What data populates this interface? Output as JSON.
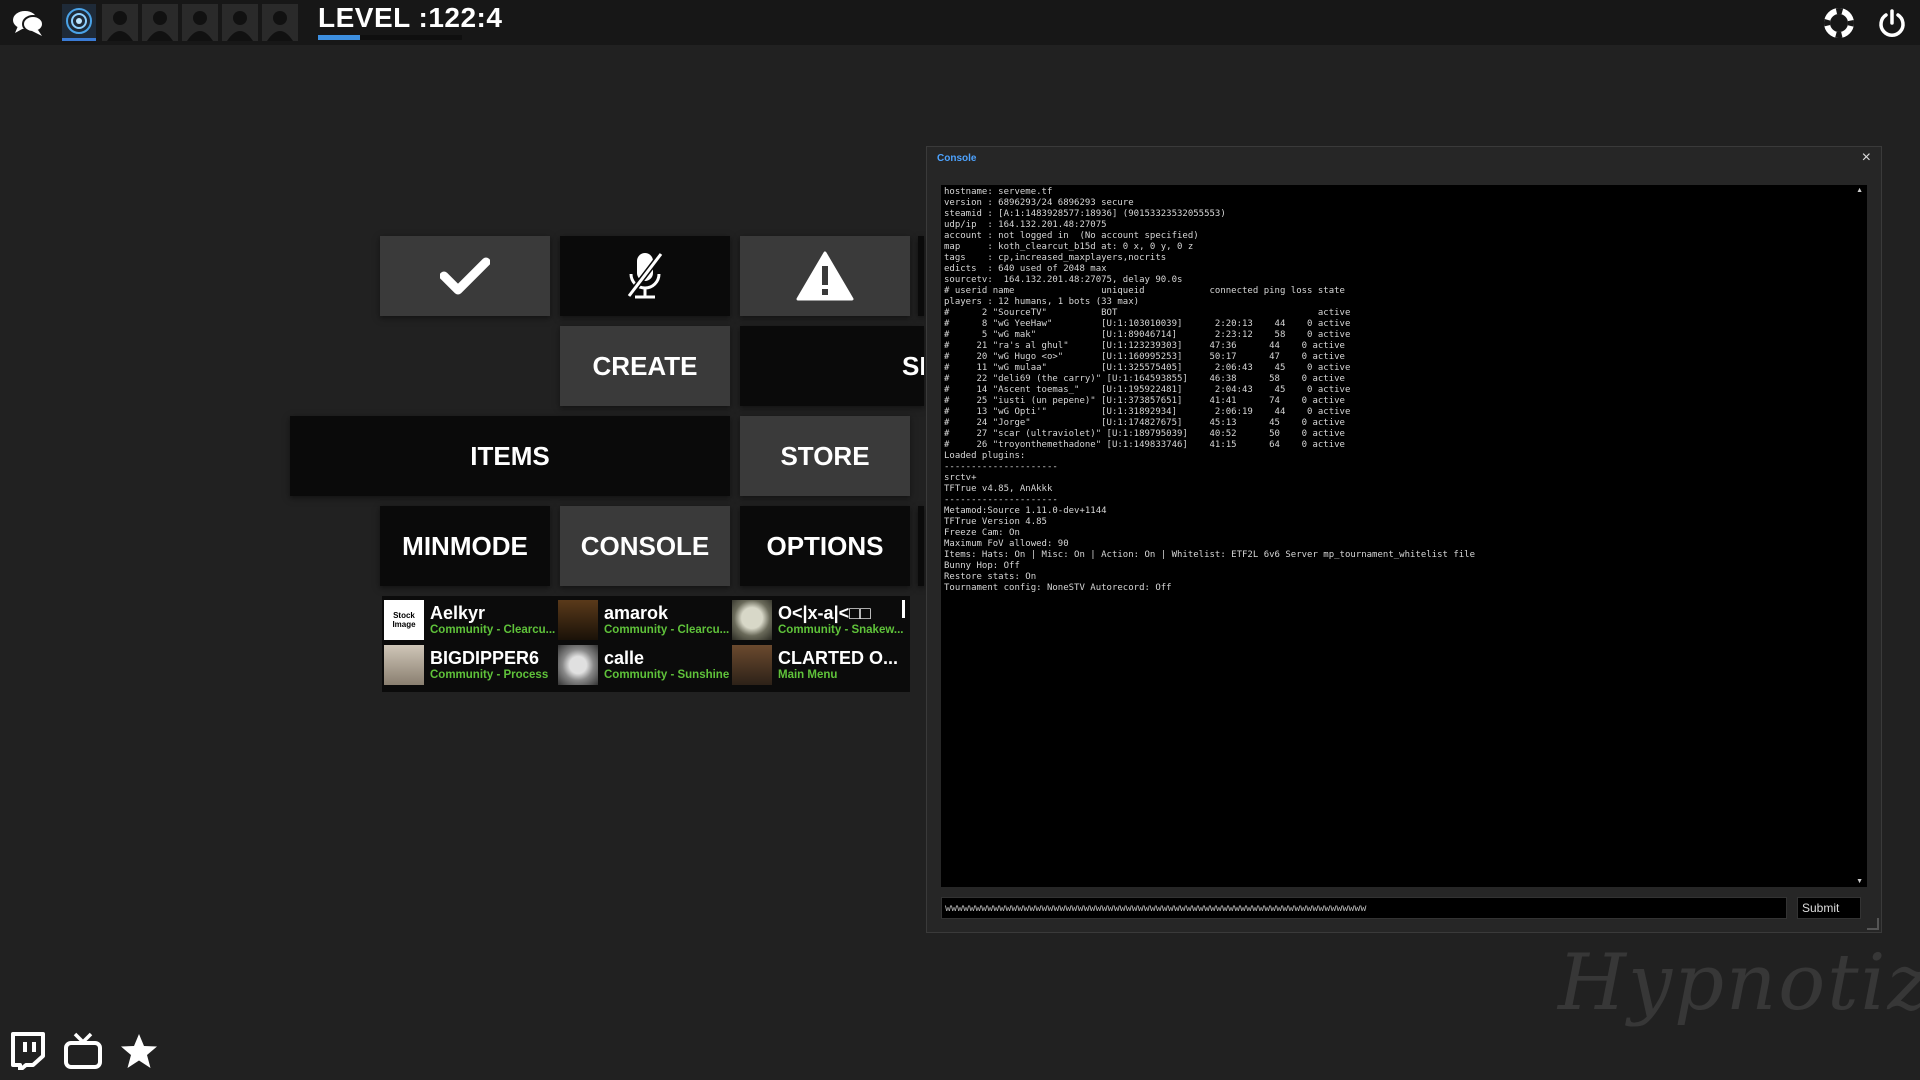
{
  "topbar": {
    "level_text": "LEVEL :122:4",
    "level_progress": 0.29
  },
  "menu": {
    "create": "CREATE",
    "server_partial": "SI",
    "items": "ITEMS",
    "store": "STORE",
    "minmode": "MINMODE",
    "console": "CONSOLE",
    "options": "OPTIONS"
  },
  "friends": [
    {
      "name": "Aelkyr",
      "status": "Community - Clearcu...",
      "pic": "Stock Image"
    },
    {
      "name": "amarok",
      "status": "Community - Clearcu...",
      "pic": ""
    },
    {
      "name": "O<|x-a|<□□",
      "status": "Community - Snakew...",
      "pic": ""
    },
    {
      "name": "BIGDIPPER6",
      "status": "Community - Process",
      "pic": ""
    },
    {
      "name": "calle",
      "status": "Community - Sunshine",
      "pic": ""
    },
    {
      "name": "CLARTED O...",
      "status": "Main Menu",
      "pic": ""
    }
  ],
  "console": {
    "title": "Console",
    "close": "×",
    "lines": [
      "hostname: serveme.tf",
      "version : 6896293/24 6896293 secure",
      "steamid : [A:1:1483928577:18936] (90153323532055553)",
      "udp/ip  : 164.132.201.48:27075",
      "account : not logged in  (No account specified)",
      "map     : koth_clearcut_b15d at: 0 x, 0 y, 0 z",
      "tags    : cp,increased_maxplayers,nocrits",
      "edicts  : 640 used of 2048 max",
      "sourcetv:  164.132.201.48:27075, delay 90.0s",
      "# userid name                uniqueid            connected ping loss state",
      "players : 12 humans, 1 bots (33 max)",
      "#      2 \"SourceTV\"          BOT                                     active",
      "#      8 \"wG YeeHaw\"         [U:1:103010039]      2:20:13    44    0 active",
      "#      5 \"wG mak\"            [U:1:89046714]       2:23:12    58    0 active",
      "#     21 \"ra's al ghul\"      [U:1:123239303]     47:36      44    0 active",
      "#     20 \"wG Hugo <o>\"       [U:1:160995253]     50:17      47    0 active",
      "#     11 \"wG mulaa\"          [U:1:325575405]      2:06:43    45    0 active",
      "#     22 \"deli69 (the carry)\" [U:1:164593855]    46:38      58    0 active",
      "#     14 \"Ascent toemas_\"    [U:1:195922481]      2:04:43    45    0 active",
      "#     25 \"iusti (un pepene)\" [U:1:373857651]     41:41      74    0 active",
      "#     13 \"wG Opti'\"          [U:1:31892934]       2:06:19    44    0 active",
      "#     24 \"Jorge\"             [U:1:174827675]     45:13      45    0 active",
      "#     27 \"scar (ultraviolet)\" [U:1:189795039]    40:52      50    0 active",
      "#     26 \"troyonthemethadone\" [U:1:149833746]    41:15      64    0 active",
      "Loaded plugins:",
      "---------------------",
      "srctv+",
      "TFTrue v4.85, AnAkkk",
      "---------------------",
      "Metamod:Source 1.11.0-dev+1144",
      "TFTrue Version 4.85",
      "Freeze Cam: On",
      "Maximum FoV allowed: 90",
      "Items: Hats: On | Misc: On | Action: On | Whitelist: ETF2L 6v6 Server mp_tournament_whitelist file",
      "Bunny Hop: Off",
      "Restore stats: On",
      "Tournament config: NoneSTV Autorecord: Off"
    ],
    "input_value": "wwwwwwwwwwwwwwwwwwwwwwwwwwwwwwwwwwwwwwwwwwwwwwwwwwwwwwwwwwwwwwwwwwwwww",
    "submit": "Submit"
  },
  "watermark": "Hypnotize",
  "icons": {
    "chat": "chat-bubbles-icon",
    "support": "lifebuoy-icon",
    "power": "power-icon",
    "confirm": "checkmark-icon",
    "mute": "mic-off-icon",
    "report": "warning-icon",
    "twitch": "twitch-icon",
    "tv": "tv-icon",
    "favorite": "star-icon"
  }
}
